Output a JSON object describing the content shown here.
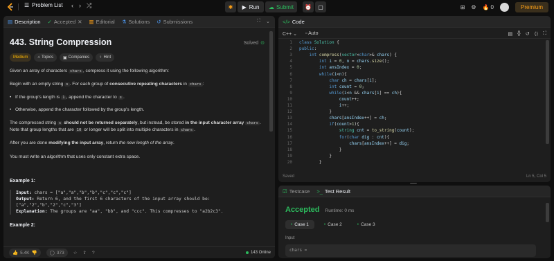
{
  "topbar": {
    "problem_list": "Problem List",
    "run": "Run",
    "submit": "Submit",
    "streak": "0",
    "premium": "Premium"
  },
  "left_tabs": [
    {
      "label": "Description"
    },
    {
      "label": "Accepted"
    },
    {
      "label": "Editorial"
    },
    {
      "label": "Solutions"
    },
    {
      "label": "Submissions"
    }
  ],
  "problem": {
    "title": "443. String Compression",
    "status": "Solved",
    "difficulty": "Medium",
    "chips": [
      "Topics",
      "Companies",
      "Hint"
    ],
    "p1_pre": "Given an array of characters ",
    "p1_code": "chars",
    "p1_post": ", compress it using the following algorithm:",
    "p2_pre": "Begin with an empty string ",
    "p2_code": "s",
    "p2_mid": ". For each group of ",
    "p2_bold": "consecutive repeating characters",
    "p2_in": " in ",
    "p2_code2": "chars",
    "p2_end": ":",
    "b1_pre": "If the group's length is ",
    "b1_code": "1",
    "b1_mid": ", append the character to ",
    "b1_code2": "s",
    "b1_end": ".",
    "b2": "Otherwise, append the character followed by the group's length.",
    "p3_a": "The compressed string ",
    "p3_code": "s",
    "p3_bold": " should not be returned separately",
    "p3_b": ", but instead, be stored ",
    "p3_bold2": "in the input character array ",
    "p3_code2": "chars",
    "p3_c": ". Note that group lengths that are ",
    "p3_code3": "10",
    "p3_d": " or longer will be split into multiple characters in ",
    "p3_code4": "chars",
    "p3_e": ".",
    "p4_a": "After you are done ",
    "p4_bold": "modifying the input array",
    "p4_b": ", return ",
    "p4_it": "the new length of the array",
    "p4_c": ".",
    "p5": "You must write an algorithm that uses only constant extra space.",
    "ex1_title": "Example 1:",
    "ex1_input_label": "Input:",
    "ex1_input": " chars = [\"a\",\"a\",\"b\",\"b\",\"c\",\"c\",\"c\"]",
    "ex1_output_label": "Output:",
    "ex1_output": " Return 6, and the first 6 characters of the input array should be:",
    "ex1_output2": "[\"a\",\"2\",\"b\",\"2\",\"c\",\"3\"]",
    "ex1_expl_label": "Explanation:",
    "ex1_expl": " The groups are \"aa\", \"bb\", and \"ccc\". This compresses to \"a2b2c3\".",
    "ex2_title": "Example 2:",
    "ex2_input": "Input: chars = [\"a\"]"
  },
  "footer": {
    "likes": "5.4K",
    "comments": "373",
    "online": "143 Online"
  },
  "code_panel": {
    "tab": "Code",
    "language": "C++",
    "mode": "Auto",
    "saved": "Saved",
    "cursor": "Ln 5, Col 5"
  },
  "code_lines": [
    "1",
    "2",
    "3",
    "4",
    "5",
    "6",
    "7",
    "8",
    "9",
    "10",
    "11",
    "12",
    "13",
    "14",
    "15",
    "16",
    "17",
    "18",
    "19",
    "20"
  ],
  "result_panel": {
    "tab_testcase": "Testcase",
    "tab_result": "Test Result",
    "status": "Accepted",
    "runtime": "Runtime: 0 ms",
    "cases": [
      "Case 1",
      "Case 2",
      "Case 3"
    ],
    "input_label": "Input",
    "input_value": "chars ="
  }
}
